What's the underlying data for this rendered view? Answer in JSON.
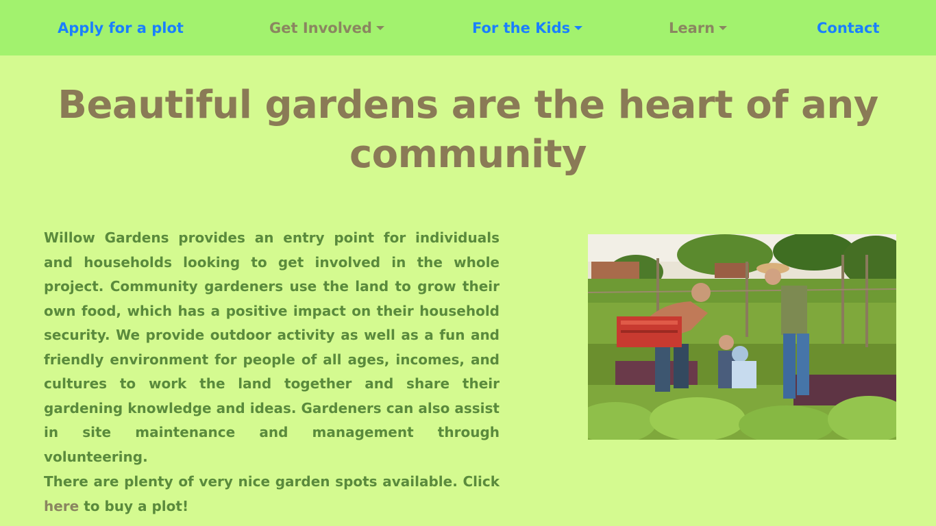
{
  "nav": {
    "items": [
      {
        "label": "Apply for a plot",
        "dropdown": false
      },
      {
        "label": "Get Involved",
        "dropdown": true
      },
      {
        "label": "For the Kids",
        "dropdown": true
      },
      {
        "label": "Learn",
        "dropdown": true
      },
      {
        "label": "Contact",
        "dropdown": false
      }
    ],
    "colors": {
      "bar": "#a2f26e",
      "active": "#1a7fff",
      "muted": "#8a8660"
    }
  },
  "hero": {
    "title": "Beautiful gardens are the heart of any community"
  },
  "main": {
    "intro": "Willow Gardens provides an entry point for individuals and households looking to get involved in the whole project. Community gardeners use the land to grow their own food, which has a positive impact on their household security. We provide outdoor activity as well as a fun and friendly environment for people of all ages, incomes, and cultures to work the land together and share their gardening knowledge and ideas. Gardeners can also assist in site maintenance and management through volunteering.",
    "cta_before": "There are plenty of very nice garden spots available. Click ",
    "cta_link": "here",
    "cta_after": " to buy a plot!",
    "image": {
      "icon": "family-gardening-photo"
    }
  },
  "colors": {
    "background": "#d4fa90",
    "heading": "#8a7a56",
    "body_text": "#5a8a3c"
  }
}
